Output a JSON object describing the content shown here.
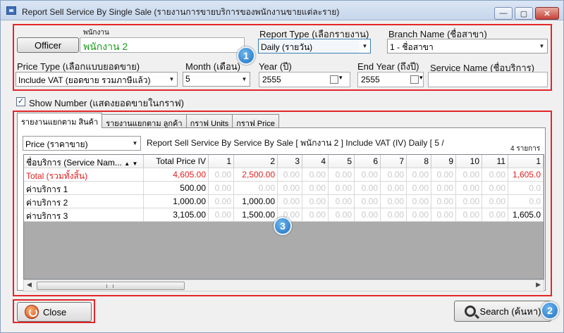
{
  "window": {
    "title": "Report Sell Service By Single Sale (รายงานการขายบริการของพนักงานขายแต่ละราย)"
  },
  "top": {
    "officer_button": "Officer",
    "employee_label": "พนักงาน",
    "employee_value": "พนักงาน 2",
    "report_type_label": "Report Type (เลือกรายงาน)",
    "report_type_value": "Daily (รายวัน)",
    "branch_label": "Branch Name (ชื่อสาขา)",
    "branch_value": "1 - ชื่อสาขา",
    "price_type_label": "Price Type (เลือกแบบยอดขาย)",
    "price_type_value": "Include VAT (ยอดขาย รวมภาษีแล้ว)",
    "month_label": "Month (เดือน)",
    "month_value": "5",
    "year_label": "Year (ปี)",
    "year_value": "2555",
    "end_year_label": "End Year (ถึงปี)",
    "end_year_value": "2555",
    "service_name_label": "Service Name (ชื่อบริการ)",
    "service_name_value": ""
  },
  "show_number": {
    "label": "Show Number (แสดงยอดขายในกราฟ)",
    "checked": true
  },
  "tabs": [
    "รายงานแยกตาม สินค้า",
    "รายงานแยกตาม ลูกค้า",
    "กราฟ Units",
    "กราฟ Price"
  ],
  "report": {
    "price_combo": "Price (ราคาขาย)",
    "caption": "Report Sell Service By Service By Sale [ พนักงาน 2 ] Include VAT (IV) Daily [ 5 /",
    "count": "4 รายการ",
    "columns": [
      "ชื่อบริการ (Service Nam...",
      "Total Price IV",
      "1",
      "2",
      "3",
      "4",
      "5",
      "6",
      "7",
      "8",
      "9",
      "10",
      "11",
      "1"
    ],
    "rows": [
      {
        "name": "Total (รวมทั้งสิ้น)",
        "total": "4,605.00",
        "c1": "0.00",
        "c2": "2,500.00",
        "c3": "0.00",
        "c4": "0.00",
        "c5": "0.00",
        "c6": "0.00",
        "c7": "0.00",
        "c8": "0.00",
        "c9": "0.00",
        "c10": "0.00",
        "c11": "0.00",
        "c12": "1,605.0"
      },
      {
        "name": "ค่าบริการ 1",
        "total": "500.00",
        "c1": "0.00",
        "c2": "0.00",
        "c3": "0.00",
        "c4": "0.00",
        "c5": "0.00",
        "c6": "0.00",
        "c7": "0.00",
        "c8": "0.00",
        "c9": "0.00",
        "c10": "0.00",
        "c11": "0.00",
        "c12": "0.0"
      },
      {
        "name": "ค่าบริการ 2",
        "total": "1,000.00",
        "c1": "0.00",
        "c2": "1,000.00",
        "c3": "0.00",
        "c4": "0.00",
        "c5": "0.00",
        "c6": "0.00",
        "c7": "0.00",
        "c8": "0.00",
        "c9": "0.00",
        "c10": "0.00",
        "c11": "0.00",
        "c12": "0.0"
      },
      {
        "name": "ค่าบริการ 3",
        "total": "3,105.00",
        "c1": "0.00",
        "c2": "1,500.00",
        "c3": "0.00",
        "c4": "0.00",
        "c5": "0.00",
        "c6": "0.00",
        "c7": "0.00",
        "c8": "0.00",
        "c9": "0.00",
        "c10": "0.00",
        "c11": "0.00",
        "c12": "1,605.0"
      }
    ]
  },
  "buttons": {
    "close": "Close",
    "search": "Search (ค้นหา)"
  },
  "badges": [
    "1",
    "2",
    "3"
  ],
  "colors": {
    "highlight_border": "#e3262a",
    "employee_text": "#1a9a1a",
    "total_row": "#e02020",
    "badge": "#1d6fbf"
  }
}
